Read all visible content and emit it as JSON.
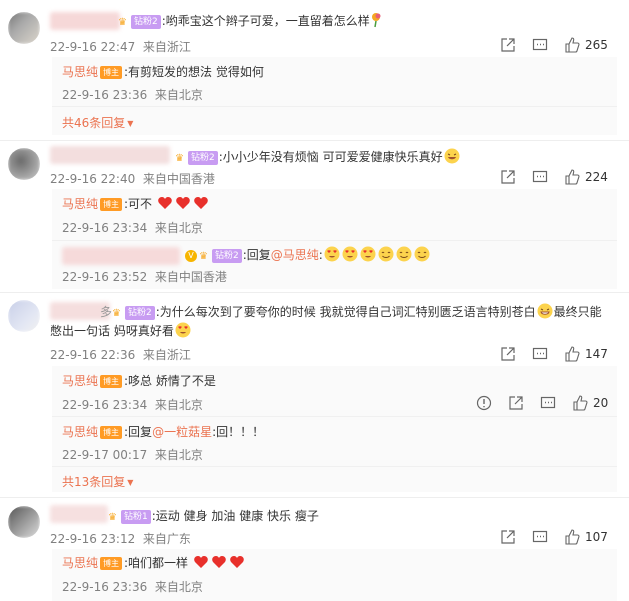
{
  "badge_labels": {
    "zuan2": "钻粉2",
    "zuan1": "钻粉1",
    "bozhu": "博主"
  },
  "colors": {
    "accent": "#eb7350",
    "meta": "#808080",
    "badge": "#c89cf2",
    "bozhu": "#ff9b25",
    "heart": "#e8302b"
  },
  "comments": [
    {
      "text": ":哟乖宝这个辫子可爱，一直留着怎么样",
      "time": "22-9-16 22:47",
      "location": "来自浙江",
      "likes": "265",
      "replies": [
        {
          "author": "马思纯",
          "text": ":有剪短发的想法 觉得如何",
          "time": "22-9-16 23:36",
          "location": "来自北京"
        }
      ],
      "more": "共46条回复"
    },
    {
      "text": ":小小少年没有烦恼 可可爱爱健康快乐真好",
      "time": "22-9-16 22:40",
      "location": "来自中国香港",
      "likes": "224",
      "replies": [
        {
          "author": "马思纯",
          "text": ":可不",
          "time": "22-9-16 23:34",
          "location": "来自北京"
        },
        {
          "text_prefix": ":回复",
          "mention": "@马思纯",
          "text_suffix": ":",
          "time": "22-9-16 23:52",
          "location": "来自中国香港"
        }
      ]
    },
    {
      "text": ":为什么每次到了要夸你的时候 我就觉得自己词汇特别匮乏语言特别苍白",
      "text2": "最终只能",
      "text3": "憋出一句话 妈呀真好看",
      "time": "22-9-16 22:36",
      "location": "来自浙江",
      "likes": "147",
      "replies": [
        {
          "author": "马思纯",
          "text": ":哆总 娇情了不是",
          "time": "22-9-16 23:34",
          "location": "来自北京",
          "likes": "20"
        },
        {
          "author": "马思纯",
          "text_prefix": ":回复",
          "mention": "@一粒菇星",
          "text_suffix": ":回！！！",
          "time": "22-9-17 00:17",
          "location": "来自北京"
        }
      ],
      "more": "共13条回复"
    },
    {
      "text": ":运动 健身 加油 健康 快乐 瘦子",
      "time": "22-9-16 23:12",
      "location": "来自广东",
      "likes": "107",
      "replies": [
        {
          "author": "马思纯",
          "text": ":咱们都一样",
          "time": "22-9-16 23:36",
          "location": "来自北京"
        }
      ]
    }
  ]
}
